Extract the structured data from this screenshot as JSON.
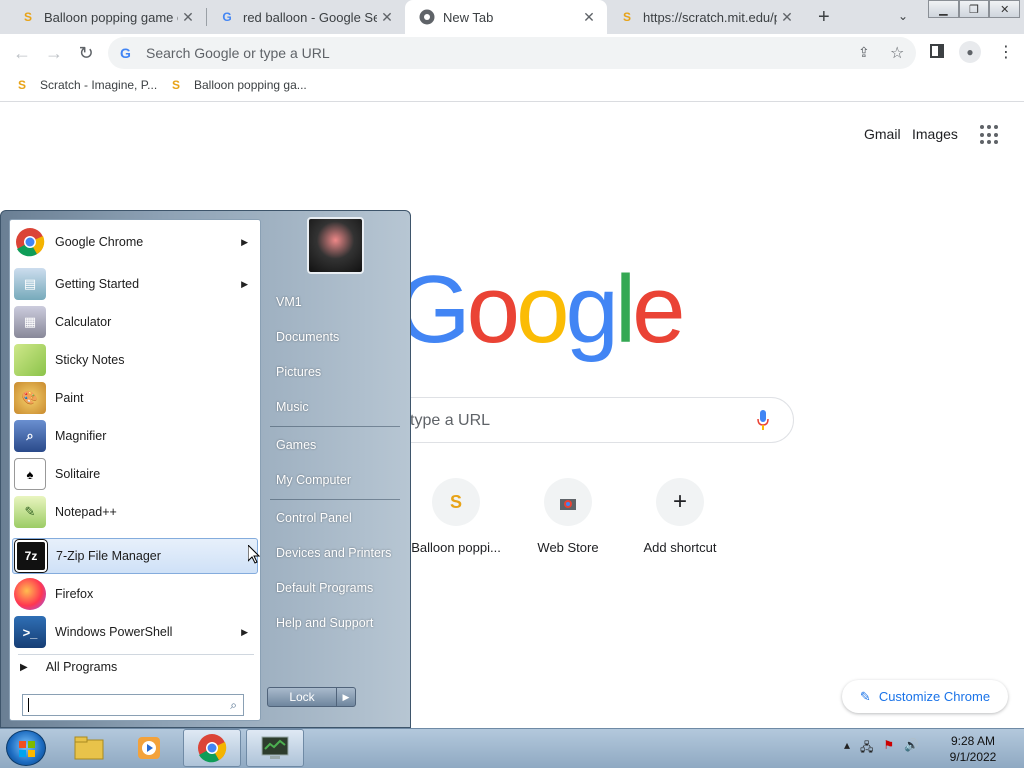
{
  "browser": {
    "tabs": [
      {
        "title": "Balloon popping game o",
        "favicon": "scratch-icon"
      },
      {
        "title": "red balloon - Google Sea",
        "favicon": "google-icon"
      },
      {
        "title": "New Tab",
        "favicon": "chrome-icon",
        "active": true
      },
      {
        "title": "https://scratch.mit.edu/p",
        "favicon": "scratch-icon"
      }
    ],
    "omnibox_placeholder": "Search Google or type a URL",
    "bookmarks": [
      {
        "label": "Scratch - Imagine, P..."
      },
      {
        "label": "Balloon popping ga..."
      }
    ]
  },
  "google": {
    "gmail": "Gmail",
    "images": "Images",
    "logo": "Google",
    "search_placeholder": "type a URL",
    "shortcuts": [
      {
        "label": "Balloon poppi..."
      },
      {
        "label": "Web Store"
      },
      {
        "label": "Add shortcut"
      }
    ],
    "customize": "Customize Chrome"
  },
  "start_menu": {
    "programs": [
      {
        "label": "Google Chrome",
        "submenu": true
      },
      {
        "label": "Getting Started",
        "submenu": true
      },
      {
        "label": "Calculator"
      },
      {
        "label": "Sticky Notes"
      },
      {
        "label": "Paint"
      },
      {
        "label": "Magnifier"
      },
      {
        "label": "Solitaire"
      },
      {
        "label": "Notepad++"
      },
      {
        "label": "7-Zip File Manager",
        "submenu": true,
        "highlighted": true
      },
      {
        "label": "Firefox"
      },
      {
        "label": "Windows PowerShell",
        "submenu": true
      }
    ],
    "all_programs": "All Programs",
    "right_links": [
      "VM1",
      "Documents",
      "Pictures",
      "Music",
      "Games",
      "My Computer",
      "Control Panel",
      "Devices and Printers",
      "Default Programs",
      "Help and Support"
    ],
    "lock": "Lock"
  },
  "taskbar": {
    "time": "9:28 AM",
    "date": "9/1/2022"
  }
}
